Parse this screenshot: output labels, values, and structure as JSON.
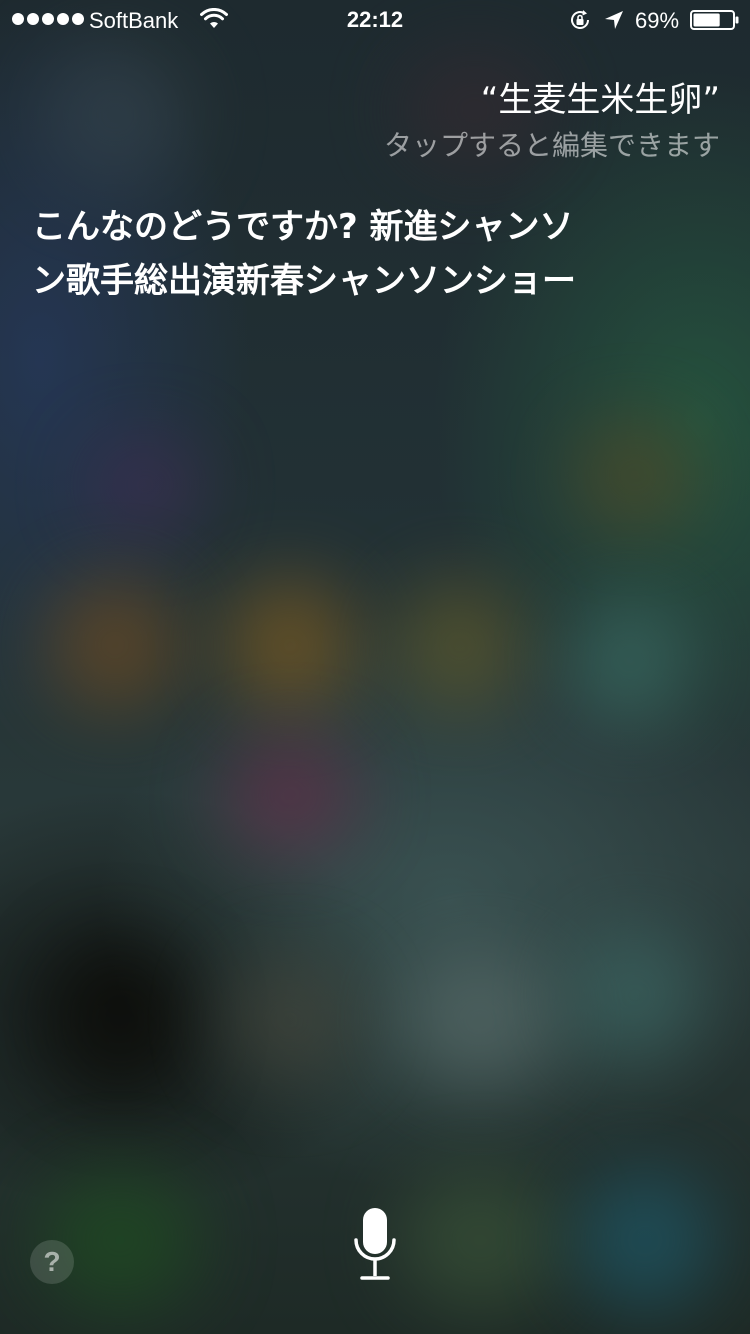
{
  "status_bar": {
    "carrier": "SoftBank",
    "time": "22:12",
    "battery_percent": "69%",
    "battery_level": 0.69
  },
  "siri": {
    "user_query": "“生麦生米生卵”",
    "edit_hint": "タップすると編集できます",
    "response": "こんなのどうですか? 新進シャンソン歌手総出演新春シャンソンショー"
  },
  "controls": {
    "help_label": "?"
  },
  "icons": {
    "signal": "signal-dots-icon",
    "wifi": "wifi-icon",
    "orientation_lock": "orientation-lock-icon",
    "location": "location-arrow-icon",
    "battery": "battery-icon",
    "microphone": "microphone-icon"
  }
}
